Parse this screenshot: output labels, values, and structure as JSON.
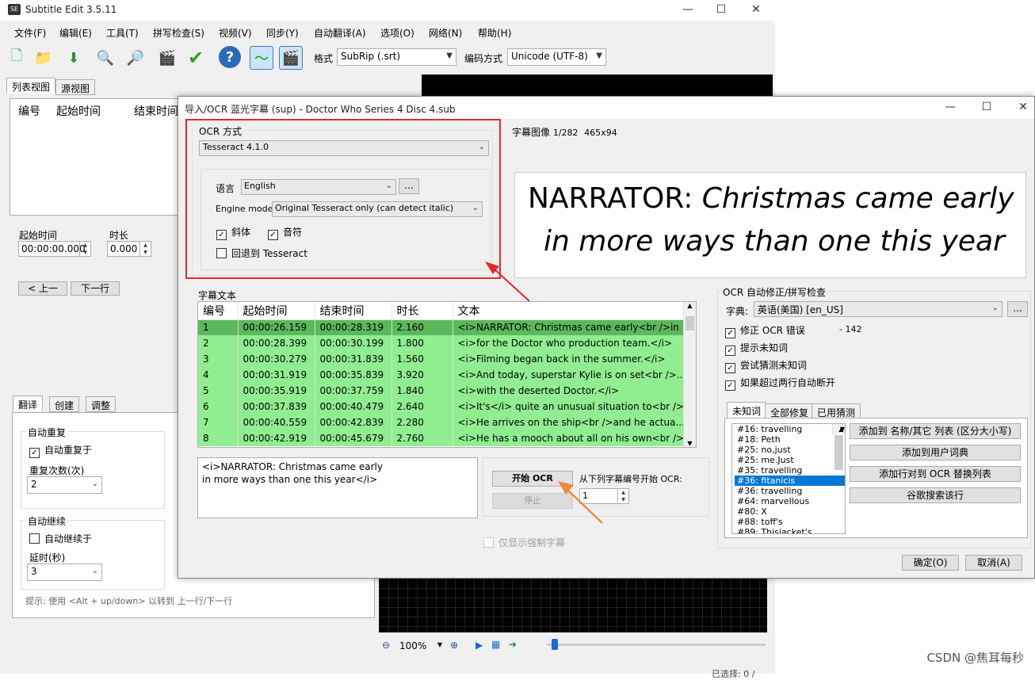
{
  "main": {
    "title": "Subtitle Edit 3.5.11",
    "menu": [
      "文件(F)",
      "编辑(E)",
      "工具(T)",
      "拼写检查(S)",
      "视频(V)",
      "同步(Y)",
      "自动翻译(A)",
      "选项(O)",
      "网络(N)",
      "帮助(H)"
    ],
    "toolbar": {
      "format_label": "格式",
      "format_value": "SubRip (.srt)",
      "encoding_label": "编码方式",
      "encoding_value": "Unicode (UTF-8)"
    },
    "view_tabs": [
      "列表视图",
      "源视图"
    ],
    "list_headers": [
      "编号",
      "起始时间",
      "结束时间"
    ],
    "start_time_label": "起始时间",
    "start_time_value": "00:00:00.000",
    "duration_label": "时长",
    "duration_value": "0.000",
    "prev_button": "< 上一",
    "next_button": "下一行",
    "bottom_tabs": [
      "翻译",
      "创建",
      "调整"
    ],
    "auto_repeat": {
      "group": "自动重复",
      "checkbox": "自动重复于",
      "count_label": "重复次数(次)",
      "count_value": "2"
    },
    "auto_continue": {
      "group": "自动继续",
      "checkbox": "自动继续于",
      "delay_label": "延时(秒)",
      "delay_value": "3"
    },
    "hint": "提示: 使用 <Alt + up/down> 以转到 上一行/下一行",
    "zoom": "100%",
    "status_partial": "已选择: 0 /"
  },
  "dialog": {
    "title": "导入/OCR 蓝光字幕 (sup) - Doctor Who Series 4 Disc 4.sub",
    "ocr_method": {
      "group": "OCR 方式",
      "engine": "Tesseract 4.1.0",
      "language_label": "语言",
      "language_value": "English",
      "more_button": "...",
      "engine_mode_label": "Engine mode",
      "engine_mode_value": "Original Tesseract only (can detect italic)",
      "italic": "斜体",
      "music": "音符",
      "fallback": "回退到 Tesseract"
    },
    "image": {
      "label": "字幕图像",
      "counter": "1/282",
      "size": "465x94",
      "line1_plain": "NARRATOR: ",
      "line1_italic": "Christmas came early",
      "line2_italic": "in more ways than one this year"
    },
    "subtitle_text_label": "字幕文本",
    "grid": {
      "headers": [
        "编号",
        "起始时间",
        "结束时间",
        "时长",
        "文本"
      ],
      "rows": [
        [
          "1",
          "00:00:26.159",
          "00:00:28.319",
          "2.160",
          "<i>NARRATOR: Christmas came early<br />in"
        ],
        [
          "2",
          "00:00:28.399",
          "00:00:30.199",
          "1.800",
          "<i>for the Doctor who production team.</i>"
        ],
        [
          "3",
          "00:00:30.279",
          "00:00:31.839",
          "1.560",
          "<i>Filming began back in the summer.</i>"
        ],
        [
          "4",
          "00:00:31.919",
          "00:00:35.839",
          "3.920",
          "<i>And today, superstar Kylie is on set<br />..."
        ],
        [
          "5",
          "00:00:35.919",
          "00:00:37.759",
          "1.840",
          "<i>with the deserted Doctor.</i>"
        ],
        [
          "6",
          "00:00:37.839",
          "00:00:40.479",
          "2.640",
          "<i>It's</i> quite an unusual situation to<br />..."
        ],
        [
          "7",
          "00:00:40.559",
          "00:00:42.839",
          "2.280",
          "<i>He arrives on the ship<br />and he actua..."
        ],
        [
          "8",
          "00:00:42.919",
          "00:00:45.679",
          "2.760",
          "<i>He has a mooch about all on his own<br />..."
        ]
      ]
    },
    "edit_text_line1": "<i>NARRATOR: Christmas came early",
    "edit_text_line2": "in more ways than one this year</i>",
    "start_ocr": "开始 OCR",
    "stop": "停止",
    "start_from_label": "从下列字幕编号开始 OCR:",
    "start_from_value": "1",
    "forced_only": "仅显示强制字幕",
    "autofix": {
      "group": "OCR 自动修正/拼写检查",
      "dict_label": "字典:",
      "dict_value": "英语(美国) [en_US]",
      "fix_errors": "修正 OCR 错误",
      "fix_count": "- 142",
      "prompt_unknown": "提示未知词",
      "guess_unknown": "尝试猜测未知词",
      "auto_break": "如果超过两行自动断开"
    },
    "word_tabs": [
      "未知词",
      "全部修复",
      "已用猜测"
    ],
    "unknown_words": [
      "#16: travelling",
      "#18: Peth",
      "#25: no,just",
      "#25: me.Just",
      "#35: travelling",
      "#36: fitanicis",
      "#36: travelling",
      "#64: marvellous",
      "#80: X",
      "#88: toff's",
      "#89: Thisjacket's"
    ],
    "selected_word_index": 5,
    "word_buttons": [
      "添加到 名称/其它 列表 (区分大小写)",
      "添加到用户词典",
      "添加行对到 OCR 替换列表",
      "谷歌搜索该行"
    ],
    "ok": "确定(O)",
    "cancel": "取消(A)"
  },
  "watermark": "CSDN @焦耳每秒",
  "colors": {
    "highlight_red": "#e8262e",
    "row_green": "#90ee90",
    "row_selected": "#5cb85c",
    "arrow_orange": "#f08a3c"
  }
}
